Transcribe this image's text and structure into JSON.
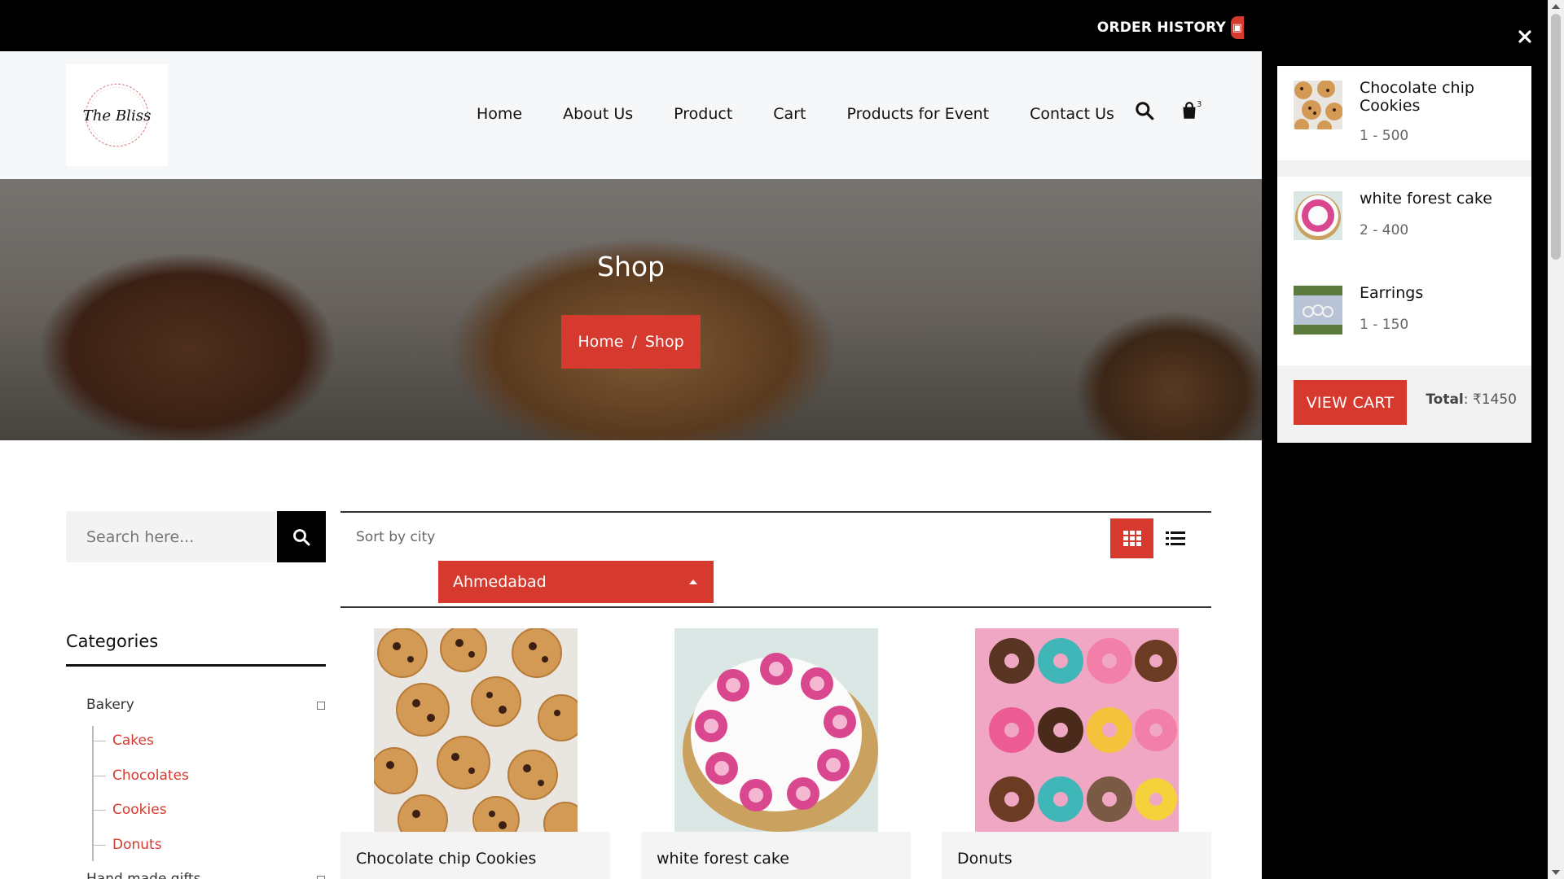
{
  "topbar": {
    "order_history": "ORDER HISTORY"
  },
  "header": {
    "logo_text": "The Bliss",
    "nav": [
      "Home",
      "About Us",
      "Product",
      "Cart",
      "Products for Event",
      "Contact Us"
    ],
    "cart_count": "3"
  },
  "hero": {
    "title": "Shop",
    "breadcrumb": {
      "home": "Home",
      "separator": "/",
      "current": "Shop"
    }
  },
  "sidebar": {
    "search_placeholder": "Search here...",
    "categories_title": "Categories",
    "parent_category": "Bakery",
    "children": [
      "Cakes",
      "Chocolates",
      "Cookies",
      "Donuts"
    ],
    "next_parent": "Hand made gifts"
  },
  "toolbar": {
    "sort_label": "Sort by city",
    "selected_city": "Ahmedabad"
  },
  "products": [
    {
      "title": "Chocolate chip Cookies"
    },
    {
      "title": "white forest cake"
    },
    {
      "title": "Donuts"
    }
  ],
  "cart_panel": {
    "items": [
      {
        "name": "Chocolate chip Cookies",
        "qty_price": "1 - 500"
      },
      {
        "name": "white forest cake",
        "qty_price": "2 - 400"
      },
      {
        "name": "Earrings",
        "qty_price": "1 - 150"
      }
    ],
    "view_cart": "VIEW CART",
    "total_label": "Total",
    "total_value": "₹1450"
  },
  "colors": {
    "accent": "#d63a2f",
    "dark": "#000000",
    "header_bg": "#f6f7f9"
  }
}
